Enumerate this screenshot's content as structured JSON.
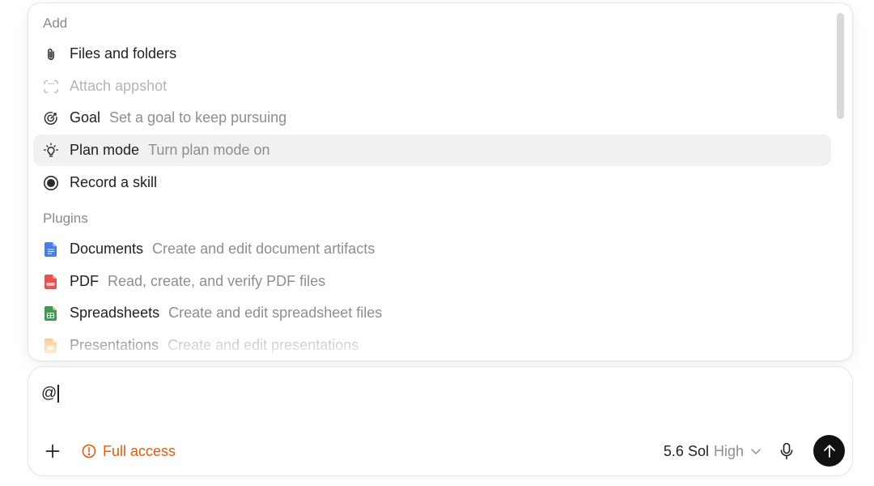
{
  "menu": {
    "add_header": "Add",
    "plugins_header": "Plugins",
    "add_items": [
      {
        "icon": "paperclip-icon",
        "label": "Files and folders",
        "desc": ""
      },
      {
        "icon": "appshot-icon",
        "label": "Attach appshot",
        "desc": ""
      },
      {
        "icon": "target-icon",
        "label": "Goal",
        "desc": "Set a goal to keep pursuing"
      },
      {
        "icon": "lightbulb-icon",
        "label": "Plan mode",
        "desc": "Turn plan mode on"
      },
      {
        "icon": "record-icon",
        "label": "Record a skill",
        "desc": ""
      }
    ],
    "plugin_items": [
      {
        "icon": "document-icon",
        "label": "Documents",
        "desc": "Create and edit document artifacts",
        "color": "#4a7fe8"
      },
      {
        "icon": "pdf-icon",
        "label": "PDF",
        "desc": "Read, create, and verify PDF files",
        "color": "#e8534f"
      },
      {
        "icon": "spreadsheet-icon",
        "label": "Spreadsheets",
        "desc": "Create and edit spreadsheet files",
        "color": "#3f9a4f"
      },
      {
        "icon": "presentation-icon",
        "label": "Presentations",
        "desc": "Create and edit presentations",
        "color": "#f0a23a"
      }
    ]
  },
  "composer": {
    "input_value": "@",
    "access_label": "Full access",
    "model_name": "5.6 Sol",
    "model_effort": "High"
  },
  "colors": {
    "accent_warning": "#e8590c",
    "send_button": "#111111",
    "highlight": "#f1f1f1"
  }
}
